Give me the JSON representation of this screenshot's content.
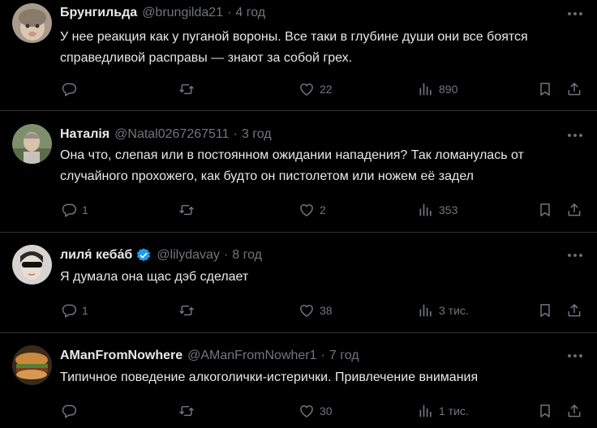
{
  "tweets": [
    {
      "name": "Брунгильда",
      "handle": "@brungilda21",
      "dot": "·",
      "time": "4 год",
      "text": "У нее реакция как у пуганой вороны. Все таки в глубине души они все боятся справедливой расправы — знают за собой грех.",
      "replies": "",
      "retweets": "",
      "likes": "22",
      "views": "890"
    },
    {
      "name": "Наталія",
      "handle": "@Natal0267267511",
      "dot": "·",
      "time": "3 год",
      "text": "Она что, слепая или в постоянном ожидании нападения? Так ломанулась от случайного прохожего, как будто он  пистолетом или ножем её задел",
      "replies": "1",
      "retweets": "",
      "likes": "2",
      "views": "353"
    },
    {
      "name": "лиля́ кеба́б",
      "handle": "@lilydavay",
      "dot": "·",
      "time": "8 год",
      "text": "Я думала она щас дэб сделает",
      "replies": "1",
      "retweets": "",
      "likes": "38",
      "views": "3 тис."
    },
    {
      "name": "AManFromNowhere",
      "handle": "@AManFromNowher1",
      "dot": "·",
      "time": "7 год",
      "text": "Типичное поведение алкоголички-истерички. Привлечение внимания",
      "replies": "",
      "retweets": "",
      "likes": "30",
      "views": "1 тис."
    }
  ],
  "icons": {
    "reply": "reply-icon",
    "retweet": "retweet-icon",
    "like": "heart-icon",
    "views": "views-icon",
    "bookmark": "bookmark-icon",
    "share": "share-icon",
    "more": "more-icon",
    "verified": "verified-badge-icon"
  },
  "colors": {
    "background": "#000000",
    "text": "#e7e9ea",
    "muted": "#71767b",
    "divider": "#2f3336",
    "verified": "#1d9bf0"
  }
}
